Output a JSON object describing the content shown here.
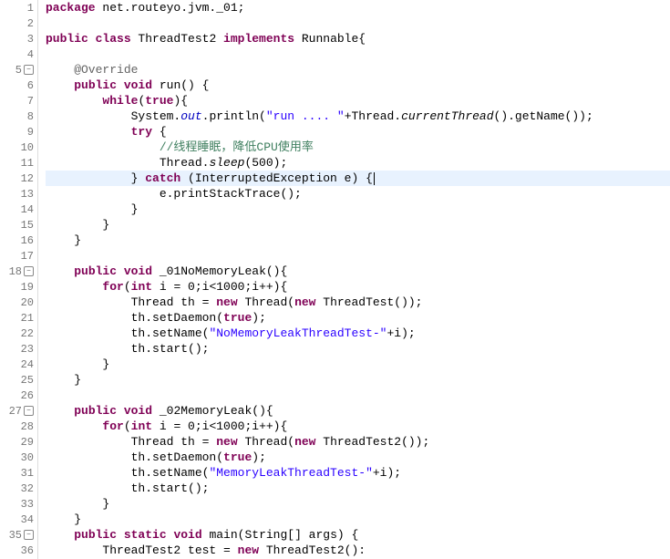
{
  "lines": [
    {
      "num": "1",
      "fold": null
    },
    {
      "num": "2",
      "fold": null
    },
    {
      "num": "3",
      "fold": null
    },
    {
      "num": "4",
      "fold": null
    },
    {
      "num": "5",
      "fold": "-"
    },
    {
      "num": "6",
      "fold": null
    },
    {
      "num": "7",
      "fold": null
    },
    {
      "num": "8",
      "fold": null
    },
    {
      "num": "9",
      "fold": null
    },
    {
      "num": "10",
      "fold": null
    },
    {
      "num": "11",
      "fold": null
    },
    {
      "num": "12",
      "fold": null
    },
    {
      "num": "13",
      "fold": null
    },
    {
      "num": "14",
      "fold": null
    },
    {
      "num": "15",
      "fold": null
    },
    {
      "num": "16",
      "fold": null
    },
    {
      "num": "17",
      "fold": null
    },
    {
      "num": "18",
      "fold": "-"
    },
    {
      "num": "19",
      "fold": null
    },
    {
      "num": "20",
      "fold": null
    },
    {
      "num": "21",
      "fold": null
    },
    {
      "num": "22",
      "fold": null
    },
    {
      "num": "23",
      "fold": null
    },
    {
      "num": "24",
      "fold": null
    },
    {
      "num": "25",
      "fold": null
    },
    {
      "num": "26",
      "fold": null
    },
    {
      "num": "27",
      "fold": "-"
    },
    {
      "num": "28",
      "fold": null
    },
    {
      "num": "29",
      "fold": null
    },
    {
      "num": "30",
      "fold": null
    },
    {
      "num": "31",
      "fold": null
    },
    {
      "num": "32",
      "fold": null
    },
    {
      "num": "33",
      "fold": null
    },
    {
      "num": "34",
      "fold": null
    },
    {
      "num": "35",
      "fold": "-"
    },
    {
      "num": "36",
      "fold": null
    }
  ],
  "code": {
    "l1_t1": "package",
    "l1_t2": " net.routeyo.jvm._01;",
    "l2": "",
    "l3_t1": "public",
    "l3_t2": " class",
    "l3_t3": " ThreadTest2 ",
    "l3_t4": "implements",
    "l3_t5": " Runnable{",
    "l4": "",
    "l5_t1": "    @Override",
    "l6_t1": "    ",
    "l6_t2": "public",
    "l6_t3": " void",
    "l6_t4": " run() {",
    "l7_t1": "        ",
    "l7_t2": "while",
    "l7_t3": "(",
    "l7_t4": "true",
    "l7_t5": "){",
    "l8_t1": "            System.",
    "l8_t2": "out",
    "l8_t3": ".println(",
    "l8_t4": "\"run .... \"",
    "l8_t5": "+Thread.",
    "l8_t6": "currentThread",
    "l8_t7": "().getName());",
    "l9_t1": "            ",
    "l9_t2": "try",
    "l9_t3": " {",
    "l10_t1": "                ",
    "l10_t2": "//线程睡眠，降低CPU使用率",
    "l11_t1": "                Thread.",
    "l11_t2": "sleep",
    "l11_t3": "(500);",
    "l12_t1": "            } ",
    "l12_t2": "catch",
    "l12_t3": " (InterruptedException e) {",
    "l13_t1": "                e.printStackTrace();",
    "l14_t1": "            }",
    "l15_t1": "        }",
    "l16_t1": "    }",
    "l17": "",
    "l18_t1": "    ",
    "l18_t2": "public",
    "l18_t3": " void",
    "l18_t4": " _01NoMemoryLeak(){",
    "l19_t1": "        ",
    "l19_t2": "for",
    "l19_t3": "(",
    "l19_t4": "int",
    "l19_t5": " i = 0;i<1000;i++){",
    "l20_t1": "            Thread th = ",
    "l20_t2": "new",
    "l20_t3": " Thread(",
    "l20_t4": "new",
    "l20_t5": " ThreadTest());",
    "l21_t1": "            th.setDaemon(",
    "l21_t2": "true",
    "l21_t3": ");",
    "l22_t1": "            th.setName(",
    "l22_t2": "\"NoMemoryLeakThreadTest-\"",
    "l22_t3": "+i);",
    "l23_t1": "            th.start();",
    "l24_t1": "        }",
    "l25_t1": "    }",
    "l26": "",
    "l27_t1": "    ",
    "l27_t2": "public",
    "l27_t3": " void",
    "l27_t4": " _02MemoryLeak(){",
    "l28_t1": "        ",
    "l28_t2": "for",
    "l28_t3": "(",
    "l28_t4": "int",
    "l28_t5": " i = 0;i<1000;i++){",
    "l29_t1": "            Thread th = ",
    "l29_t2": "new",
    "l29_t3": " Thread(",
    "l29_t4": "new",
    "l29_t5": " ThreadTest2());",
    "l30_t1": "            th.setDaemon(",
    "l30_t2": "true",
    "l30_t3": ");",
    "l31_t1": "            th.setName(",
    "l31_t2": "\"MemoryLeakThreadTest-\"",
    "l31_t3": "+i);",
    "l32_t1": "            th.start();",
    "l33_t1": "        }",
    "l34_t1": "    }",
    "l35_t1": "    ",
    "l35_t2": "public",
    "l35_t3": " static",
    "l35_t4": " void",
    "l35_t5": " main(String[] args) {",
    "l36_t1": "        ThreadTest2 test = ",
    "l36_t2": "new",
    "l36_t3": " ThreadTest2():"
  }
}
